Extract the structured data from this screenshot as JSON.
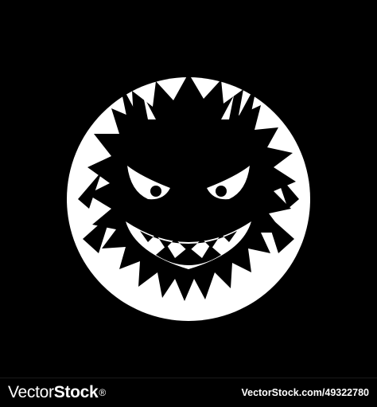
{
  "footer": {
    "brand_left": "Vector",
    "brand_right": "Stock",
    "brand_mark": "®",
    "credit": "VectorStock.com/49322780"
  },
  "illustration": {
    "subject": "monster-face-icon",
    "background_color": "#000000",
    "foreground_color": "#ffffff"
  }
}
